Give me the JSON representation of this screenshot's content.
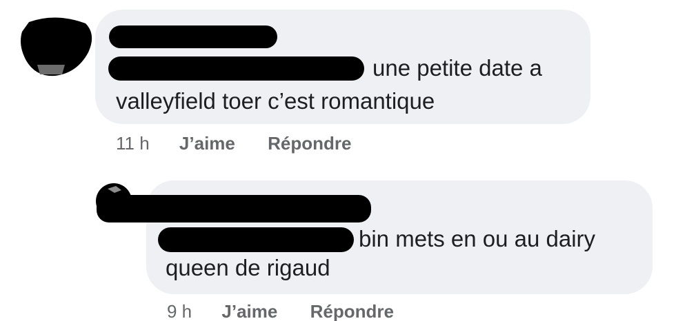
{
  "comments": [
    {
      "text_line1": "une petite date a",
      "text_line2": "valleyfield toer c’est romantique",
      "time": "11 h",
      "like_label": "J’aime",
      "reply_label": "Répondre"
    },
    {
      "text_line1": "bin mets en ou au dairy",
      "text_line2": "queen de rigaud",
      "time": "9 h",
      "like_label": "J’aime",
      "reply_label": "Répondre"
    }
  ],
  "colors": {
    "bubble": "#eff0f4",
    "text": "#1c1e21",
    "meta": "#65676b",
    "redaction": "#000000"
  }
}
